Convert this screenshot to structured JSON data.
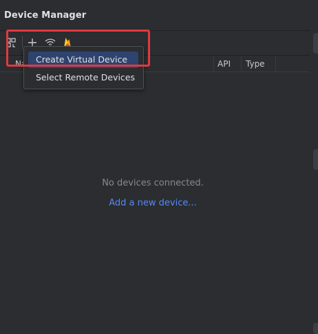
{
  "panel": {
    "title": "Device Manager"
  },
  "toolbar": {
    "icons": [
      "device-manager-icon",
      "plus-icon",
      "wifi-icon",
      "firebase-icon"
    ]
  },
  "table": {
    "columns": [
      "Na",
      "API",
      "Type"
    ]
  },
  "menu": {
    "items": [
      {
        "label": "Create Virtual Device",
        "selected": true
      },
      {
        "label": "Select Remote Devices",
        "selected": false
      }
    ]
  },
  "empty_state": {
    "message": "No devices connected.",
    "link": "Add a new device..."
  },
  "colors": {
    "background": "#2b2d30",
    "link": "#548af7",
    "highlight_border": "#e2393e",
    "menu_selected": "#2e436e"
  }
}
